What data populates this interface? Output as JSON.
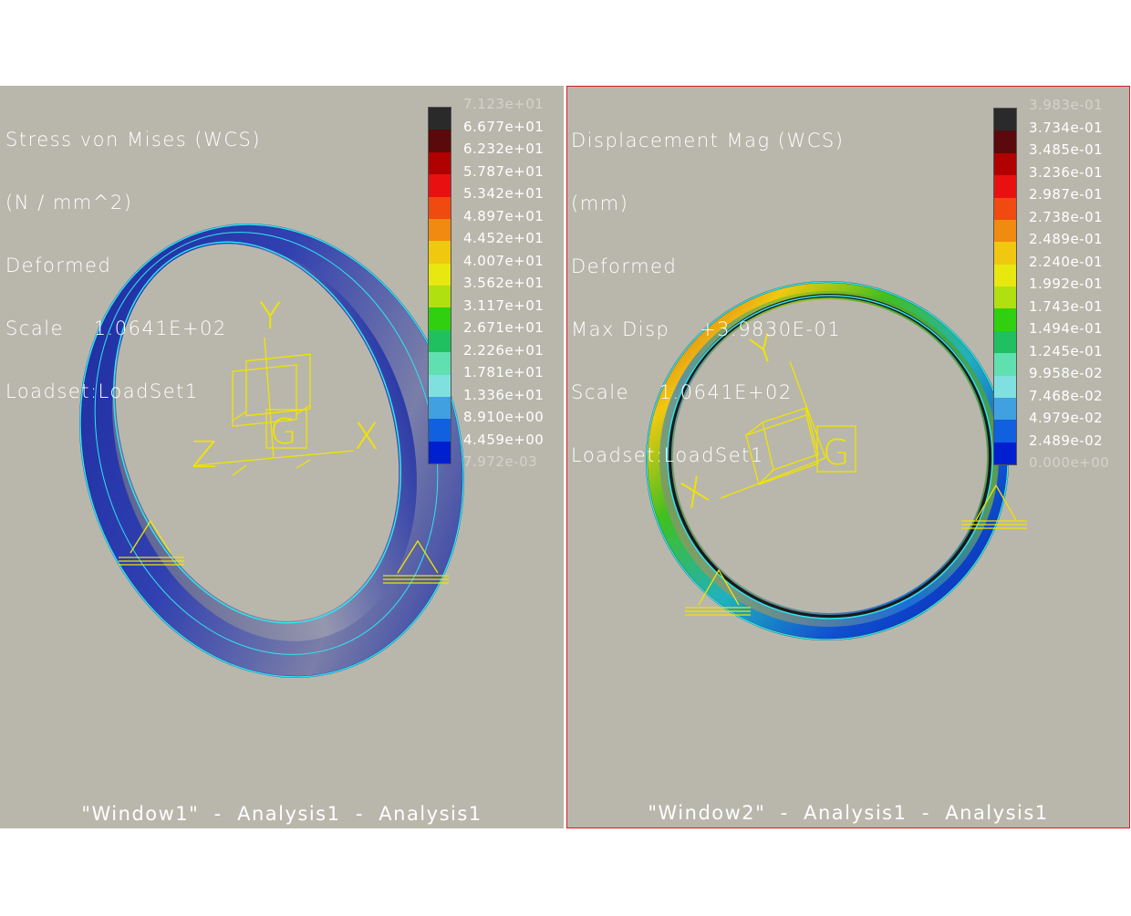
{
  "colors": {
    "background": "#b9b7ac",
    "active_border": "#d41e1e",
    "wireframe": "#f0e400",
    "outline": "#2ee5f0"
  },
  "legend_colors": [
    "#2a2a2a",
    "#5a0a0a",
    "#b00000",
    "#e81010",
    "#f04a10",
    "#f08a10",
    "#f0c810",
    "#e8e810",
    "#b0e010",
    "#30d010",
    "#20c060",
    "#60e0b0",
    "#80e0e0",
    "#40a0e0",
    "#1060e0",
    "#0020d0",
    "#5a5aa0"
  ],
  "window1": {
    "info_lines": [
      "Stress von Mises (WCS)",
      "(N / mm^2)",
      "Deformed",
      "Scale    1.0641E+02",
      "Loadset:LoadSet1"
    ],
    "legend_labels": [
      "7.123e+01",
      "6.677e+01",
      "6.232e+01",
      "5.787e+01",
      "5.342e+01",
      "4.897e+01",
      "4.452e+01",
      "4.007e+01",
      "3.562e+01",
      "3.117e+01",
      "2.671e+01",
      "2.226e+01",
      "1.781e+01",
      "1.336e+01",
      "8.910e+00",
      "4.459e+00",
      "7.972e-03"
    ],
    "axes": {
      "x": "X",
      "y": "Y",
      "z": "Z"
    },
    "csys_label": "G",
    "footer": "\"Window1\"  -  Analysis1  -  Analysis1"
  },
  "window2": {
    "info_lines": [
      "Displacement Mag (WCS)",
      "(mm)",
      "Deformed",
      "Max Disp    +3.9830E-01",
      "Scale    1.0641E+02",
      "Loadset:LoadSet1"
    ],
    "legend_labels": [
      "3.983e-01",
      "3.734e-01",
      "3.485e-01",
      "3.236e-01",
      "2.987e-01",
      "2.738e-01",
      "2.489e-01",
      "2.240e-01",
      "1.992e-01",
      "1.743e-01",
      "1.494e-01",
      "1.245e-01",
      "9.958e-02",
      "7.468e-02",
      "4.979e-02",
      "2.489e-02",
      "0.000e+00"
    ],
    "axes": {
      "x": "X",
      "y": "Y"
    },
    "csys_label": "G",
    "footer": "\"Window2\"  -  Analysis1  -  Analysis1"
  }
}
